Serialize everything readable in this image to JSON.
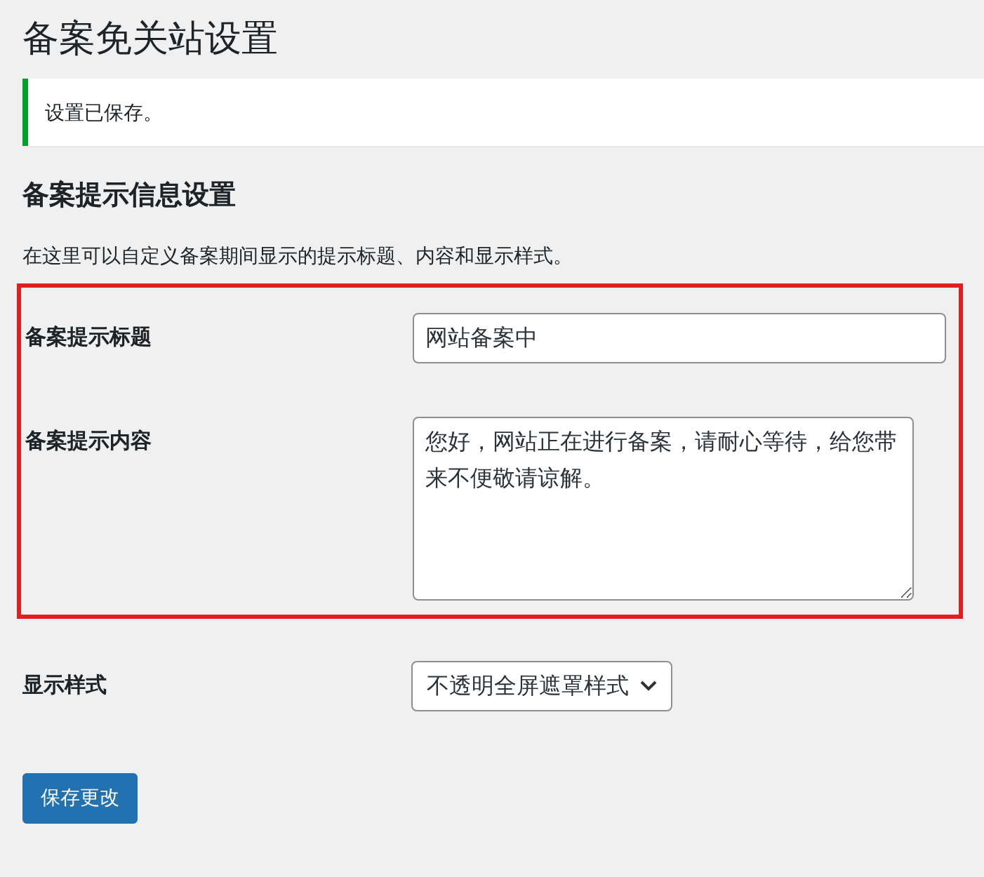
{
  "page_title": "备案免关站设置",
  "notice": {
    "text": "设置已保存。"
  },
  "section": {
    "heading": "备案提示信息设置",
    "description": "在这里可以自定义备案期间显示的提示标题、内容和显示样式。"
  },
  "highlighted_fields": [
    {
      "kind": "text",
      "label": "备案提示标题",
      "value": "网站备案中"
    },
    {
      "kind": "textarea",
      "label": "备案提示内容",
      "value": "您好，网站正在进行备案，请耐心等待，给您带来不便敬请谅解。"
    }
  ],
  "other_fields": [
    {
      "kind": "select",
      "label": "显示样式",
      "value": "不透明全屏遮罩样式"
    }
  ],
  "save_button": "保存更改"
}
